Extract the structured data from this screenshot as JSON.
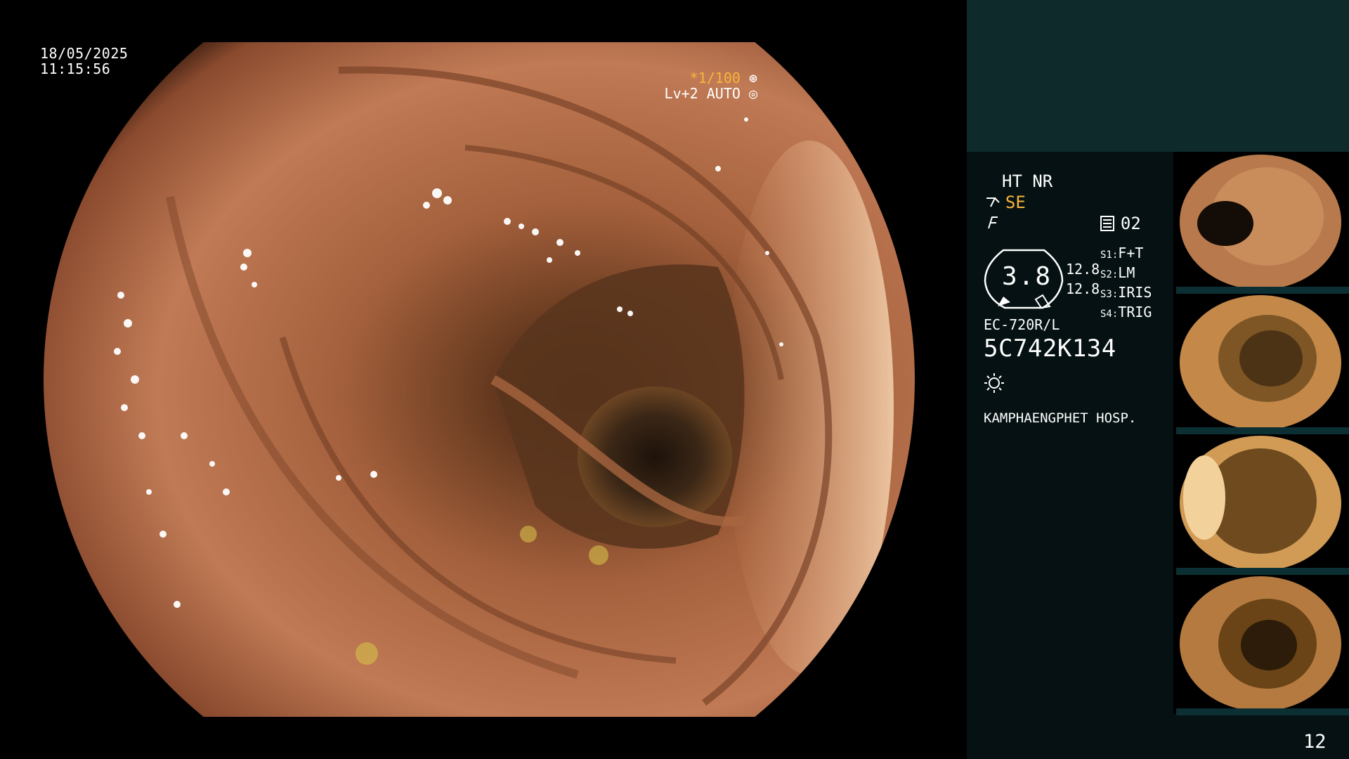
{
  "overlay": {
    "date": "18/05/2025",
    "time": "11:15:56",
    "shutter": "*1/100",
    "level": "Lv+2 AUTO"
  },
  "panel": {
    "ht_nr": "HT NR",
    "se": "SE",
    "channel": "02",
    "gauge_value": "3.8",
    "val1": "12.8",
    "val2": "12.8",
    "s_items": [
      {
        "label": "S1:",
        "value": "F+T"
      },
      {
        "label": "S2:",
        "value": "LM"
      },
      {
        "label": "S3:",
        "value": "IRIS"
      },
      {
        "label": "S4:",
        "value": "TRIG"
      }
    ],
    "scope_model": "EC-720R/L",
    "serial": "5C742K134",
    "hospital": "KAMPHAENGPHET HOSP.",
    "page": "12"
  },
  "colors": {
    "accent": "#f7b53a",
    "panel_top": "#0f2a2b",
    "panel_bottom": "#051112"
  },
  "icons": [
    "shutter-icon",
    "auto-icon",
    "se-icon",
    "flash-icon",
    "channel-icon",
    "sun-icon"
  ]
}
